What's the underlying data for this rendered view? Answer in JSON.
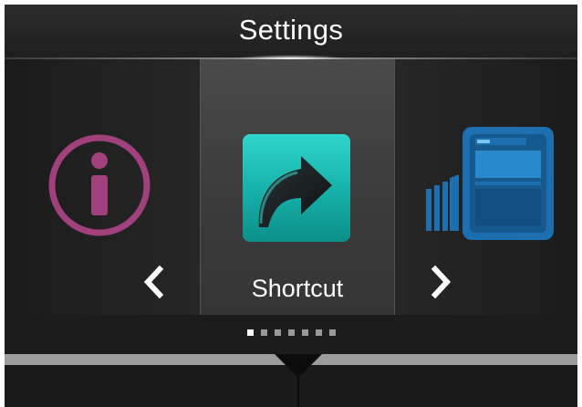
{
  "header": {
    "title": "Settings"
  },
  "carousel": {
    "items": [
      {
        "name": "info",
        "icon": "info-icon",
        "color": "#a0407c"
      },
      {
        "name": "shortcut",
        "label": "Shortcut",
        "icon": "shortcut-arrow-icon",
        "color": "#1bb8b0",
        "selected": true
      },
      {
        "name": "printer",
        "icon": "printer-icon",
        "color": "#1c6fb0"
      }
    ],
    "prev_icon": "chevron-left-icon",
    "next_icon": "chevron-right-icon"
  },
  "pager": {
    "total": 7,
    "active_index": 0
  },
  "colors": {
    "background": "#1c1c1c",
    "selected_tile": "#3f3f3f",
    "text": "#ffffff"
  }
}
